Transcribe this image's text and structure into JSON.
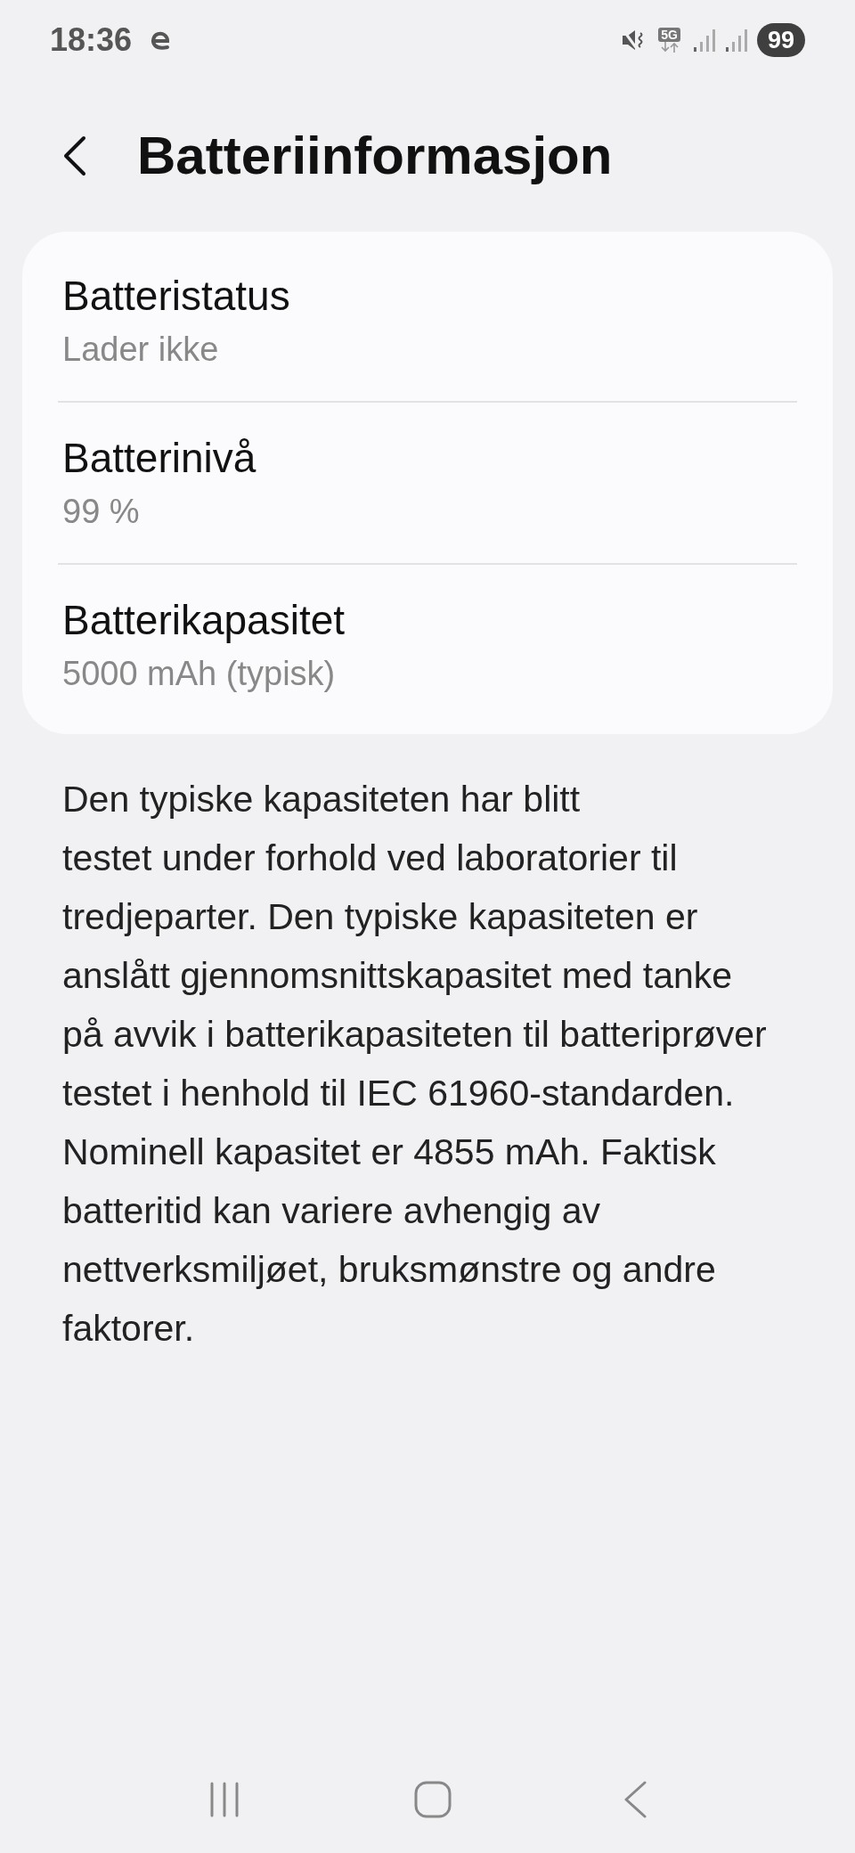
{
  "status_bar": {
    "time": "18:36",
    "network": "5G",
    "battery": "99"
  },
  "header": {
    "title": "Batteriinformasjon"
  },
  "items": [
    {
      "title": "Batteristatus",
      "value": "Lader ikke"
    },
    {
      "title": "Batterinivå",
      "value": "99 %"
    },
    {
      "title": "Batterikapasitet",
      "value": "5000 mAh (typisk)"
    }
  ],
  "note": "Den typiske kapasiteten har blitt\ntestet under forhold ved laboratorier til\ntredjeparter. Den typiske kapasiteten er\nanslått gjennomsnittskapasitet med tanke\npå avvik i batterikapasiteten til batteriprøver\ntestet i henhold til IEC 61960-standarden.\nNominell kapasitet er 4855 mAh. Faktisk\nbatteritid kan variere avhengig av\nnettverksmiljøet, bruksmønstre og andre\nfaktorer."
}
